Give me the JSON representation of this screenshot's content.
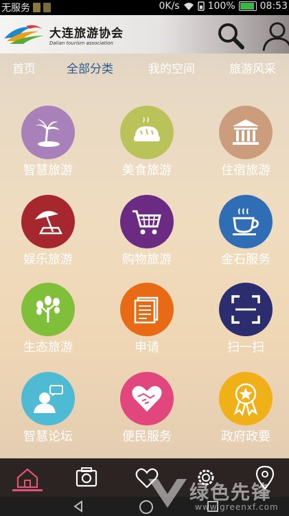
{
  "status": {
    "carrier": "无服务",
    "speed": "0K/s",
    "battery": "100%",
    "time": "08:53"
  },
  "header": {
    "title_cn": "大连旅游协会",
    "title_en": "Dalian tourism association"
  },
  "tabs": [
    {
      "label": "首页"
    },
    {
      "label": "全部分类"
    },
    {
      "label": "我的空间"
    },
    {
      "label": "旅游风采"
    }
  ],
  "grid": [
    {
      "label": "智慧旅游",
      "icon": "palm-island-icon",
      "color": "#a881bb"
    },
    {
      "label": "美食旅游",
      "icon": "bread-icon",
      "color": "#b9c35a"
    },
    {
      "label": "住宿旅游",
      "icon": "building-columns-icon",
      "color": "#cb9d7c"
    },
    {
      "label": "娱乐旅游",
      "icon": "beach-umbrella-icon",
      "color": "#a6272e"
    },
    {
      "label": "购物旅游",
      "icon": "shopping-cart-icon",
      "color": "#6b2b82"
    },
    {
      "label": "金石服务",
      "icon": "coffee-cup-icon",
      "color": "#2f6db5"
    },
    {
      "label": "生态旅游",
      "icon": "tree-icon",
      "color": "#7fbf3a"
    },
    {
      "label": "申请",
      "icon": "documents-icon",
      "color": "#e86a14"
    },
    {
      "label": "扫一扫",
      "icon": "scan-icon",
      "color": "#2b2d6e"
    },
    {
      "label": "智慧论坛",
      "icon": "user-chat-icon",
      "color": "#4fbad4"
    },
    {
      "label": "便民服务",
      "icon": "heart-handshake-icon",
      "color": "#e1477d"
    },
    {
      "label": "政府政要",
      "icon": "award-badge-icon",
      "color": "#f0b017"
    }
  ],
  "bottom_nav": [
    {
      "icon": "home-icon",
      "active": true
    },
    {
      "icon": "camera-icon"
    },
    {
      "icon": "heart-icon"
    },
    {
      "icon": "settings-gear-icon"
    },
    {
      "icon": "location-pin-icon"
    }
  ],
  "watermark": {
    "cn": "绿色先锋",
    "en": "www.greenxf.com"
  },
  "colors": {
    "active_tab": "#2a5a90",
    "nav_underline": "#e25577",
    "nav_bg": "#2c2423"
  }
}
